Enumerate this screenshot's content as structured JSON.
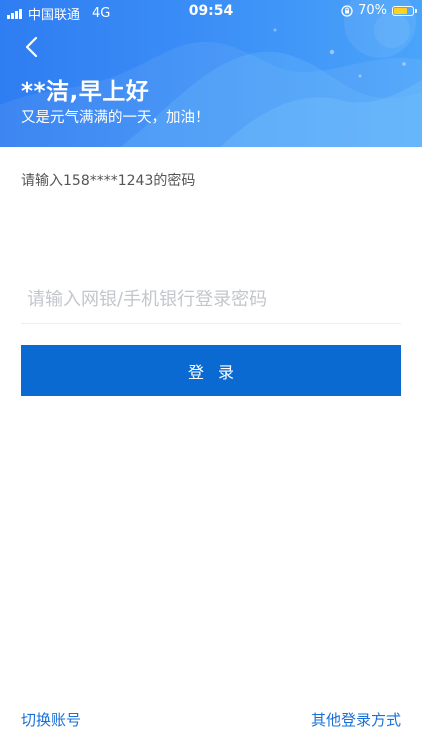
{
  "status_bar": {
    "carrier": "中国联通",
    "network": "4G",
    "time": "09:54",
    "battery": "70%",
    "battery_level": 0.7,
    "battery_color": "#ffd21f"
  },
  "header": {
    "greeting": "**洁,早上好",
    "subtitle": "又是元气满满的一天，加油！",
    "gradient_start": "#2f7df2",
    "gradient_end": "#4aa4fa"
  },
  "form": {
    "prompt": "请输入158****1243的密码",
    "password_placeholder": "请输入网银/手机银行登录密码",
    "password_value": "",
    "login_label": "登录",
    "button_color": "#0b6ad2"
  },
  "footer": {
    "switch_account": "切换账号",
    "other_login": "其他登录方式",
    "link_color": "#1a6fd8"
  },
  "icons": {
    "back": "chevron-left-icon",
    "signal": "signal-icon",
    "lock": "rotation-lock-icon",
    "battery": "battery-icon"
  }
}
